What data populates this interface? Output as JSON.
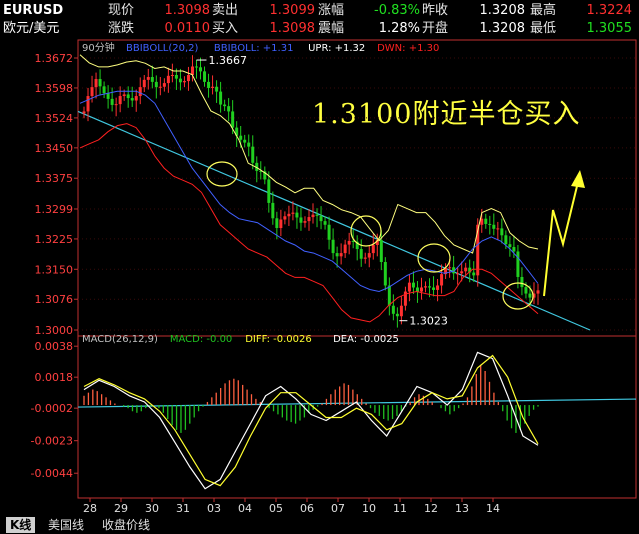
{
  "quote": {
    "symbol": "EURUSD",
    "name": "欧元/美元",
    "rows": [
      [
        {
          "label": "现价",
          "value": "1.3098",
          "color": "up"
        },
        {
          "label": "卖出",
          "value": "1.3099",
          "color": "up"
        },
        {
          "label": "涨幅",
          "value": "-0.83%",
          "color": "dn"
        },
        {
          "label": "昨收",
          "value": "1.3208",
          "color": "wh"
        },
        {
          "label": "最高",
          "value": "1.3224",
          "color": "up"
        }
      ],
      [
        {
          "label": "涨跌",
          "value": "0.0110",
          "color": "up"
        },
        {
          "label": "买入",
          "value": "1.3098",
          "color": "up"
        },
        {
          "label": "震幅",
          "value": "1.28%",
          "color": "wh"
        },
        {
          "label": "开盘",
          "value": "1.3208",
          "color": "wh"
        },
        {
          "label": "最低",
          "value": "1.3055",
          "color": "dn"
        }
      ]
    ]
  },
  "annotation": "1.3100附近半仓买入",
  "tabs": [
    "K线",
    "美国线",
    "收盘价线"
  ],
  "colors": {
    "up": "#ff3030",
    "down": "#20d020",
    "axis": "#c03030",
    "trend": "#40c8e0",
    "bb_upper": "#ffff80",
    "bb_mid": "#4060ff",
    "bb_lower": "#ff2020",
    "dif": "#ffffff",
    "dea": "#ffff30",
    "macd_pos": "#ff6040",
    "macd_neg": "#20c020",
    "arrow": "#ffff30"
  },
  "chart_data": [
    {
      "type": "candlestick",
      "period_label": "90分钟",
      "indicator_labels": [
        {
          "text": "BBIBOLL(20,2)",
          "color": "#4060ff"
        },
        {
          "text": "BBIBOLL: +1.31",
          "color": "#4060ff"
        },
        {
          "text": "UPR: +1.32",
          "color": "#ffffff"
        },
        {
          "text": "DWN: +1.30",
          "color": "#ff2020"
        }
      ],
      "y_ticks": [
        "1.3672",
        "1.3598",
        "1.3524",
        "1.3450",
        "1.3375",
        "1.3299",
        "1.3225",
        "1.3150",
        "1.3076",
        "1.3000"
      ],
      "ylim": [
        1.3,
        1.3672
      ],
      "annotations": [
        {
          "label": "1.3667",
          "at": "high"
        },
        {
          "label": "1.3023",
          "at": "low"
        }
      ],
      "x_ticks": [
        "28",
        "29",
        "30",
        "31",
        "03",
        "04",
        "05",
        "06",
        "07",
        "10",
        "11",
        "12",
        "13",
        "14"
      ],
      "close": [
        1.354,
        1.3578,
        1.36,
        1.362,
        1.3602,
        1.3585,
        1.3571,
        1.3556,
        1.3558,
        1.3578,
        1.3582,
        1.3573,
        1.3567,
        1.3578,
        1.36,
        1.3618,
        1.3625,
        1.3613,
        1.36,
        1.3601,
        1.361,
        1.3628,
        1.363,
        1.3621,
        1.3612,
        1.3615,
        1.363,
        1.3651,
        1.3649,
        1.3639,
        1.3613,
        1.3598,
        1.3601,
        1.3589,
        1.3557,
        1.3553,
        1.354,
        1.35,
        1.348,
        1.347,
        1.3463,
        1.3453,
        1.3413,
        1.3393,
        1.3392,
        1.3372,
        1.3314,
        1.3276,
        1.3252,
        1.3273,
        1.3281,
        1.3287,
        1.329,
        1.3278,
        1.3265,
        1.3269,
        1.3279,
        1.3285,
        1.3282,
        1.3269,
        1.326,
        1.3223,
        1.319,
        1.3182,
        1.319,
        1.3211,
        1.322,
        1.3218,
        1.32,
        1.3176,
        1.3179,
        1.319,
        1.321,
        1.3222,
        1.3168,
        1.311,
        1.306,
        1.304,
        1.3034,
        1.306,
        1.3095,
        1.3117,
        1.3105,
        1.3095,
        1.3105,
        1.3108,
        1.3105,
        1.3099,
        1.311,
        1.3138,
        1.3153,
        1.3155,
        1.314,
        1.314,
        1.3145,
        1.3154,
        1.3142,
        1.3135,
        1.326,
        1.3275,
        1.3262,
        1.326,
        1.325,
        1.3251,
        1.3234,
        1.3212,
        1.3205,
        1.3194,
        1.3131,
        1.3106,
        1.309,
        1.308,
        1.309,
        1.3098
      ],
      "bb_upper": [
        1.368,
        1.366,
        1.365,
        1.365,
        1.3655,
        1.3662,
        1.3665,
        1.3659,
        1.3646,
        1.365,
        1.364,
        1.364,
        1.3631,
        1.3584,
        1.3541,
        1.353,
        1.351,
        1.347,
        1.3412,
        1.34,
        1.3385,
        1.3365,
        1.3353,
        1.3339,
        1.335,
        1.335,
        1.332,
        1.331,
        1.3297,
        1.329,
        1.328,
        1.325,
        1.3221,
        1.3246,
        1.331,
        1.33,
        1.329,
        1.329,
        1.3266,
        1.3233,
        1.321,
        1.32,
        1.319,
        1.329,
        1.33,
        1.329,
        1.324,
        1.322,
        1.3205,
        1.32
      ],
      "bb_mid": [
        1.356,
        1.357,
        1.358,
        1.3585,
        1.359,
        1.359,
        1.359,
        1.358,
        1.356,
        1.352,
        1.348,
        1.344,
        1.34,
        1.337,
        1.334,
        1.331,
        1.329,
        1.3275,
        1.327,
        1.3265,
        1.325,
        1.3235,
        1.322,
        1.321,
        1.3195,
        1.319,
        1.318,
        1.317,
        1.315,
        1.313,
        1.311,
        1.31,
        1.3095,
        1.3105,
        1.312,
        1.3135,
        1.3145,
        1.315,
        1.3145,
        1.314,
        1.3145,
        1.317,
        1.32,
        1.322,
        1.323,
        1.322,
        1.32,
        1.3175,
        1.3145,
        1.3115
      ],
      "bb_lower": [
        1.345,
        1.346,
        1.347,
        1.349,
        1.3505,
        1.351,
        1.35,
        1.347,
        1.343,
        1.34,
        1.338,
        1.337,
        1.336,
        1.334,
        1.33,
        1.326,
        1.324,
        1.322,
        1.32,
        1.319,
        1.318,
        1.316,
        1.314,
        1.313,
        1.313,
        1.312,
        1.311,
        1.308,
        1.305,
        1.303,
        1.3025,
        1.302,
        1.3035,
        1.306,
        1.308,
        1.309,
        1.3095,
        1.309,
        1.3085,
        1.3085,
        1.3095,
        1.313,
        1.315,
        1.315,
        1.314,
        1.312,
        1.31,
        1.308,
        1.306,
        1.304
      ]
    },
    {
      "type": "macd",
      "label": "MACD(26,12,9)",
      "indicator_labels": [
        {
          "text": "MACD: -0.00",
          "color": "#20c020"
        },
        {
          "text": "DIFF: -0.0026",
          "color": "#ffff30"
        },
        {
          "text": "DEA: -0.0025",
          "color": "#ffffff"
        }
      ],
      "y_ticks": [
        "0.0038",
        "0.0018",
        "-0.0002",
        "-0.0023",
        "-0.0044"
      ],
      "ylim": [
        -0.006,
        0.0042
      ],
      "hist": [
        0.0006,
        0.0008,
        0.001,
        0.0009,
        0.0007,
        0.0005,
        0.0003,
        0.0001,
        0.0,
        -0.0001,
        -0.0002,
        -0.0004,
        -0.0005,
        -0.0004,
        -0.0002,
        -0.0001,
        0.0,
        -0.0002,
        -0.0005,
        -0.0009,
        -0.0013,
        -0.0016,
        -0.0018,
        -0.0016,
        -0.0012,
        -0.0008,
        -0.0004,
        -0.0001,
        0.0002,
        0.0005,
        0.0008,
        0.0011,
        0.0014,
        0.0016,
        0.0017,
        0.0016,
        0.0013,
        0.001,
        0.0007,
        0.0004,
        0.0002,
        0.0,
        -0.0002,
        -0.0004,
        -0.0006,
        -0.0008,
        -0.001,
        -0.0011,
        -0.0012,
        -0.001,
        -0.0008,
        -0.0005,
        -0.0003,
        -0.0001,
        0.0001,
        0.0004,
        0.0007,
        0.001,
        0.0012,
        0.0014,
        0.0013,
        0.001,
        0.0007,
        0.0004,
        0.0001,
        -0.0002,
        -0.0005,
        -0.0007,
        -0.0009,
        -0.001,
        -0.0009,
        -0.0007,
        -0.0004,
        -0.0001,
        0.0002,
        0.0005,
        0.0007,
        0.0006,
        0.0004,
        0.0002,
        0.0,
        -0.0002,
        -0.0004,
        -0.0006,
        -0.0004,
        -0.0002,
        0.0001,
        0.0005,
        0.0012,
        0.002,
        0.0026,
        0.0022,
        0.0015,
        0.0008,
        0.0002,
        -0.0004,
        -0.001,
        -0.0015,
        -0.0018,
        -0.0016,
        -0.0012,
        -0.0007,
        -0.0003,
        -0.0001
      ],
      "dif": [
        0.001,
        0.0016,
        0.0012,
        0.0006,
        0.0002,
        -0.0008,
        -0.0024,
        -0.004,
        -0.0054,
        -0.0048,
        -0.003,
        -0.0012,
        0.0006,
        0.0012,
        0.0004,
        -0.0006,
        -0.001,
        -0.0004,
        0.0002,
        -0.001,
        -0.002,
        -0.0004,
        0.0012,
        0.0008,
        0.0,
        0.001,
        0.0034,
        0.003,
        0.0006,
        -0.002,
        -0.0026
      ],
      "dea": [
        0.0012,
        0.0017,
        0.0013,
        0.0008,
        0.0004,
        -0.0004,
        -0.0016,
        -0.0032,
        -0.0048,
        -0.0052,
        -0.004,
        -0.002,
        -0.0002,
        0.0008,
        0.0008,
        0.0,
        -0.0008,
        -0.0008,
        -0.0002,
        -0.0006,
        -0.0016,
        -0.0012,
        0.0002,
        0.0008,
        0.0004,
        0.0006,
        0.0024,
        0.0032,
        0.0018,
        -0.0008,
        -0.0025
      ]
    }
  ]
}
